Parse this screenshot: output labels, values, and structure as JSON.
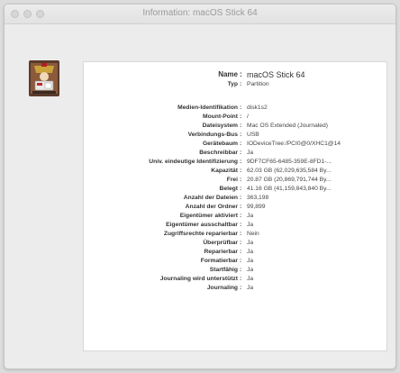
{
  "window": {
    "title": "Information: macOS Stick 64"
  },
  "header": {
    "name_label": "Name",
    "name_value": "macOS Stick 64",
    "type_label": "Typ",
    "type_value": "Partition"
  },
  "details": [
    {
      "label": "Medien-Identifikation",
      "value": "disk1s2"
    },
    {
      "label": "Mount-Point",
      "value": "/"
    },
    {
      "label": "Dateisystem",
      "value": "Mac OS Extended (Journaled)"
    },
    {
      "label": "Verbindungs-Bus",
      "value": "USB"
    },
    {
      "label": "Gerätebaum",
      "value": "IODeviceTree:/PCI0@0/XHC1@14"
    },
    {
      "label": "Beschreibbar",
      "value": "Ja"
    },
    {
      "label": "Univ. eindeutige Identifizierung",
      "value": "9DF7CF65-6485-359E-8FD1-..."
    },
    {
      "label": "Kapazität",
      "value": "62.03 GB (62,029,635,584 By..."
    },
    {
      "label": "Frei",
      "value": "20.87 GB (20,869,791,744 By..."
    },
    {
      "label": "Belegt",
      "value": "41.16 GB (41,159,843,840 By..."
    },
    {
      "label": "Anzahl der Dateien",
      "value": "363,198"
    },
    {
      "label": "Anzahl der Ordner",
      "value": "99,899"
    },
    {
      "label": "Eigentümer aktiviert",
      "value": "Ja"
    },
    {
      "label": "Eigentümer ausschaltbar",
      "value": "Ja"
    },
    {
      "label": "Zugriffsrechte reparierbar",
      "value": "Nein"
    },
    {
      "label": "Überprüfbar",
      "value": "Ja"
    },
    {
      "label": "Reparierbar",
      "value": "Ja"
    },
    {
      "label": "Formatierbar",
      "value": "Ja"
    },
    {
      "label": "Startfähig",
      "value": "Ja"
    },
    {
      "label": "Journaling wird unterstützt",
      "value": "Ja"
    },
    {
      "label": "Journaling",
      "value": "Ja"
    }
  ],
  "icons": {
    "disk_icon": "usb-disk-icon"
  }
}
